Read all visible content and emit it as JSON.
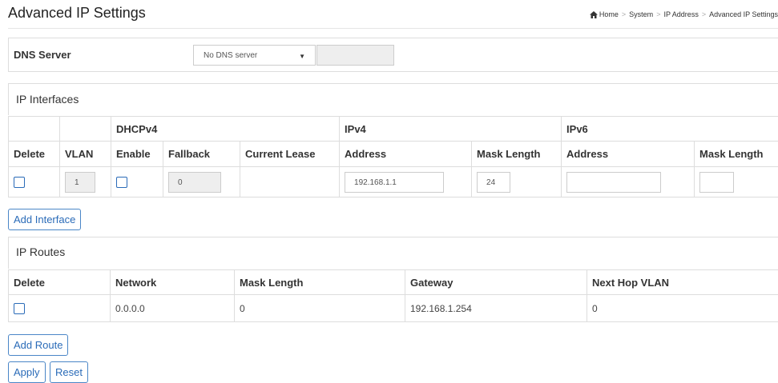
{
  "page": {
    "title": "Advanced IP Settings",
    "breadcrumb": [
      "Home",
      "System",
      "IP Address",
      "Advanced IP Settings"
    ]
  },
  "dns": {
    "label": "DNS Server",
    "select_value": "No DNS server"
  },
  "ip_interfaces": {
    "title": "IP Interfaces",
    "group_headers": {
      "dhcpv4": "DHCPv4",
      "ipv4": "IPv4",
      "ipv6": "IPv6"
    },
    "columns": {
      "delete": "Delete",
      "vlan": "VLAN",
      "enable": "Enable",
      "fallback": "Fallback",
      "current_lease": "Current Lease",
      "ipv4_address": "Address",
      "ipv4_mask": "Mask Length",
      "ipv6_address": "Address",
      "ipv6_mask": "Mask Length"
    },
    "rows": [
      {
        "vlan": "1",
        "fallback": "0",
        "current_lease": "",
        "ipv4_address": "192.168.1.1",
        "ipv4_mask": "24",
        "ipv6_address": "",
        "ipv6_mask": ""
      }
    ],
    "add_button": "Add Interface"
  },
  "ip_routes": {
    "title": "IP Routes",
    "columns": {
      "delete": "Delete",
      "network": "Network",
      "mask_length": "Mask Length",
      "gateway": "Gateway",
      "next_hop_vlan": "Next Hop VLAN"
    },
    "rows": [
      {
        "network": "0.0.0.0",
        "mask_length": "0",
        "gateway": "192.168.1.254",
        "next_hop_vlan": "0"
      }
    ],
    "add_button": "Add Route"
  },
  "actions": {
    "apply": "Apply",
    "reset": "Reset"
  },
  "colors": {
    "accent": "#2a6bb8",
    "border": "#dddddd",
    "readonly_bg": "#eeeeee"
  }
}
